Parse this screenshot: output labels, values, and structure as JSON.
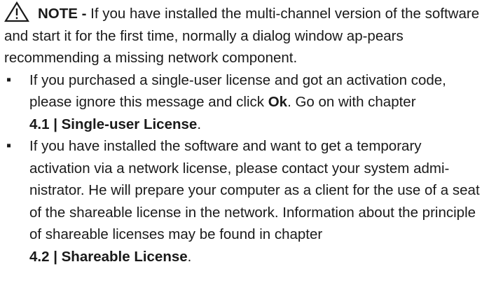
{
  "note": {
    "icon": "warning-triangle-icon",
    "label": "NOTE -",
    "text": " If you have installed the multi-channel version of the software and start it for the first time, normally a dialog window ap-pears recommending a missing network component."
  },
  "bullets": [
    {
      "text_before": "If you purchased a single-user license and got an activation code, please ignore this message and click ",
      "strong": "Ok",
      "text_after": ". Go on with chapter ",
      "chapter_ref": "4.1 | Single-user License",
      "end": "."
    },
    {
      "text_before": "If you have installed the software and want to get a temporary activation via a network license, please contact your system admi-nistrator. He will prepare your computer as a client for the use of a seat of the shareable license in the network. Information about the principle of shareable licenses may be found in chapter ",
      "chapter_ref": "4.2 | Shareable License",
      "end": "."
    }
  ],
  "bullet_symbol": "▪"
}
